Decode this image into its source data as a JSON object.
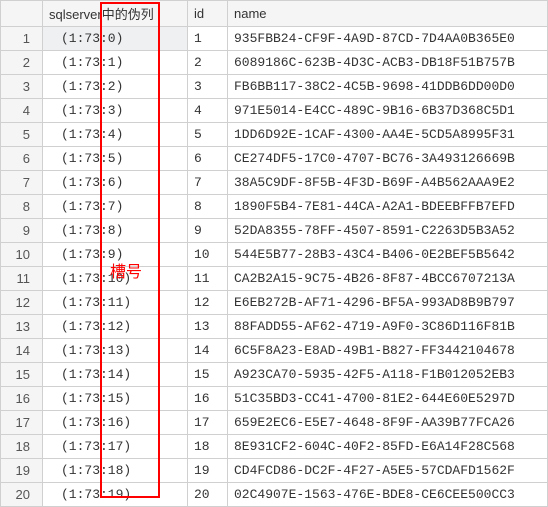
{
  "columns": {
    "pseudo": "sqlserver中的伪列",
    "id": "id",
    "name": "name"
  },
  "annotation_label": "槽号",
  "rows": [
    {
      "rownum": "1",
      "pseudo": "(1:73:0)",
      "id": "1",
      "name": "935FBB24-CF9F-4A9D-87CD-7D4AA0B365E0"
    },
    {
      "rownum": "2",
      "pseudo": "(1:73:1)",
      "id": "2",
      "name": "6089186C-623B-4D3C-ACB3-DB18F51B757B"
    },
    {
      "rownum": "3",
      "pseudo": "(1:73:2)",
      "id": "3",
      "name": "FB6BB117-38C2-4C5B-9698-41DDB6DD00D0"
    },
    {
      "rownum": "4",
      "pseudo": "(1:73:3)",
      "id": "4",
      "name": "971E5014-E4CC-489C-9B16-6B37D368C5D1"
    },
    {
      "rownum": "5",
      "pseudo": "(1:73:4)",
      "id": "5",
      "name": "1DD6D92E-1CAF-4300-AA4E-5CD5A8995F31"
    },
    {
      "rownum": "6",
      "pseudo": "(1:73:5)",
      "id": "6",
      "name": "CE274DF5-17C0-4707-BC76-3A493126669B"
    },
    {
      "rownum": "7",
      "pseudo": "(1:73:6)",
      "id": "7",
      "name": "38A5C9DF-8F5B-4F3D-B69F-A4B562AAA9E2"
    },
    {
      "rownum": "8",
      "pseudo": "(1:73:7)",
      "id": "8",
      "name": "1890F5B4-7E81-44CA-A2A1-BDEEBFFB7EFD"
    },
    {
      "rownum": "9",
      "pseudo": "(1:73:8)",
      "id": "9",
      "name": "52DA8355-78FF-4507-8591-C2263D5B3A52"
    },
    {
      "rownum": "10",
      "pseudo": "(1:73:9)",
      "id": "10",
      "name": "544E5B77-28B3-43C4-B406-0E2BEF5B5642"
    },
    {
      "rownum": "11",
      "pseudo": "(1:73:10)",
      "id": "11",
      "name": "CA2B2A15-9C75-4B26-8F87-4BCC6707213A"
    },
    {
      "rownum": "12",
      "pseudo": "(1:73:11)",
      "id": "12",
      "name": "E6EB272B-AF71-4296-BF5A-993AD8B9B797"
    },
    {
      "rownum": "13",
      "pseudo": "(1:73:12)",
      "id": "13",
      "name": "88FADD55-AF62-4719-A9F0-3C86D116F81B"
    },
    {
      "rownum": "14",
      "pseudo": "(1:73:13)",
      "id": "14",
      "name": "6C5F8A23-E8AD-49B1-B827-FF3442104678"
    },
    {
      "rownum": "15",
      "pseudo": "(1:73:14)",
      "id": "15",
      "name": "A923CA70-5935-42F5-A118-F1B012052EB3"
    },
    {
      "rownum": "16",
      "pseudo": "(1:73:15)",
      "id": "16",
      "name": "51C35BD3-CC41-4700-81E2-644E60E5297D"
    },
    {
      "rownum": "17",
      "pseudo": "(1:73:16)",
      "id": "17",
      "name": "659E2EC6-E5E7-4648-8F9F-AA39B77FCA26"
    },
    {
      "rownum": "18",
      "pseudo": "(1:73:17)",
      "id": "18",
      "name": "8E931CF2-604C-40F2-85FD-E6A14F28C568"
    },
    {
      "rownum": "19",
      "pseudo": "(1:73:18)",
      "id": "19",
      "name": "CD4FCD86-DC2F-4F27-A5E5-57CDAFD1562F"
    },
    {
      "rownum": "20",
      "pseudo": "(1:73:19)",
      "id": "20",
      "name": "02C4907E-1563-476E-BDE8-CE6CEE500CC3"
    }
  ]
}
